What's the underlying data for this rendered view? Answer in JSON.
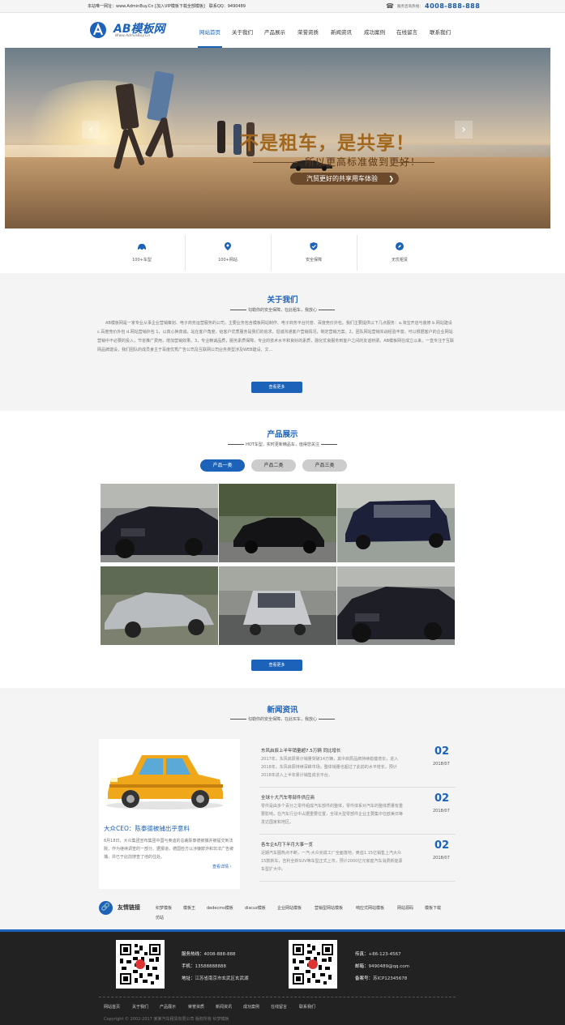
{
  "topbar": {
    "welcome": "本站唯一网址：www.AdminBuy.Cn [加入VIP模板下载全部模板]　联系QQ：9490489",
    "hotline_label": "服务咨询热线：",
    "hotline": "4008-888-888"
  },
  "header": {
    "logo_text": "AB模板网",
    "logo_sub": "Www.AdminBuy.Cn",
    "nav": [
      "网站首页",
      "关于我们",
      "产品展示",
      "荣誉资质",
      "新闻资讯",
      "成功案例",
      "在线留言",
      "联系我们"
    ]
  },
  "banner": {
    "title": "不是租车，是共享！",
    "subtitle": "所以更高标准做到更好！",
    "button": "汽贸更好的共享用车体验",
    "arrow": "❯",
    "prev": "‹",
    "next": "›"
  },
  "features": [
    {
      "icon": "car-icon",
      "label": "100+车型"
    },
    {
      "icon": "location-icon",
      "label": "100+网站"
    },
    {
      "icon": "shield-icon",
      "label": "安全保障"
    },
    {
      "icon": "compass-icon",
      "label": "无忧租赁"
    }
  ],
  "about": {
    "title": "关于我们",
    "subtitle": "勾勒你的安全保障，在此租车，我放心",
    "text": "AB模板网是一家专业从事企业营销策划、电子商务运营服务的公司，主要业务包含模板网站制作、电子商务平台托管、百度竞价外包。我们主要提供以下几点服务：a.淘宝开店与装修 b.网站建设 c.百度竞价外包 d.网站营销外包 1，以真心换真诚，站在客户角度，给客户优质服务是我们的追求，坦诚沟通客户营销情况，制定营销方案。2，团队网站营销实战经验丰富，可以根据客户的企业网站营销中不必要的投入，节省推广费用，增加营销效果。3，专业精诚品质，服务素质保障，专业的技术水平和良好的素质，融化优良服务到客户之间的友谊桥梁。AB模板网在成立以来，一直专注于互联网品牌建设，我们团队的成员食主于百度优秀广告公司及互联网公司业务类型涉及WEB建设、文...",
    "more": "查看更多"
  },
  "products": {
    "title": "产品展示",
    "subtitle": "HOT车型，实时更新精品车，值得您关注",
    "tabs": [
      "产品一类",
      "产品二类",
      "产品三类"
    ],
    "more": "查看更多"
  },
  "news": {
    "title": "新闻资讯",
    "subtitle": "勾勒你的安全保障，在此买车，我放心",
    "featured": {
      "title": "大众CEO：陈泰德被捕出乎意料",
      "text": "6月18日，大众集团宣布集团中国与奥迪的总裁陈泰德被捕并被提交到法院，作为继续调查的一部分。据报道，德国检方以涉嫌欺诈和非法广告被捕，并已于此前搜查了他的住处。",
      "more": "查看详情 ›"
    },
    "items": [
      {
        "title": "东风启辰上半年销量超7.5万辆 同比增长",
        "desc": "2017年，东风启辰累计销量突破14万辆，其中启辰品牌持续稳健增长，进入2018年，东风启辰持续深耕市场，整体销量也超过了此前的水平增长，预计2018年进入上半年累计销售成长平台。",
        "day": "02",
        "ym": "2018/07"
      },
      {
        "title": "全球十大汽车零部件供应商",
        "desc": "零件是由多个百分之零件组成汽车部件的整体，零件体系对汽车的整体质量有重要影响，在汽车行业中占据重要位置，全球大型零部件企业主要集中在欧美日等发达国家和地区。",
        "day": "02",
        "ym": "2018/07"
      },
      {
        "title": "各车企6月下半月大事一览",
        "desc": "近期汽车圈热点不断，一汽-大众完成工厂全面落地，奥迪1.15亿销售上汽大众15款新车，吉利全新SUV等车型正式上市，预计2000亿元家庭汽车消费新能源车型扩大中。",
        "day": "02",
        "ym": "2018/07"
      }
    ]
  },
  "links": {
    "title": "友情链接",
    "items": [
      "织梦模板",
      "模板王",
      "dedecms模板",
      "discuz模板",
      "企业网站模板",
      "营销型网站模板",
      "响应式网站模板",
      "网站源码",
      "模板下载",
      "仿站"
    ]
  },
  "footer": {
    "left": [
      {
        "label": "服务热线：",
        "value": "4008-888-888"
      },
      {
        "label": "手机：",
        "value": "13588888888"
      },
      {
        "label": "地址：",
        "value": "江苏省南京市玄武区玄武湖"
      }
    ],
    "right": [
      {
        "label": "传真：",
        "value": "+86-123-4567"
      },
      {
        "label": "邮箱：",
        "value": "9490489@qq.com"
      },
      {
        "label": "备案号：",
        "value": "苏ICP12345678"
      }
    ],
    "nav": [
      "网站首页",
      "关于我们",
      "产品展示",
      "荣誉资质",
      "新闻资讯",
      "成功案例",
      "在线留言",
      "联系我们"
    ],
    "copyright": "Copyright © 2002-2017 某某汽车租赁有限公司 版权所有 织梦模板"
  },
  "colors": {
    "accent": "#1b62b8",
    "footer_bg": "#222222",
    "section_bg": "#f4f4f4"
  }
}
